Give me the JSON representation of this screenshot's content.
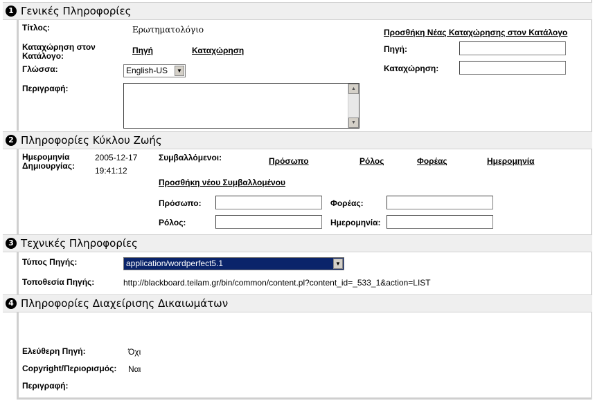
{
  "general": {
    "num": "1",
    "title": "Γενικές Πληροφορίες",
    "title_label": "Τίτλος:",
    "title_value": "Ερωτηματολόγιο",
    "catalog_label": "Καταχώρηση στον Κατάλογο:",
    "col_source": "Πηγή",
    "col_entry": "Καταχώρηση",
    "language_label": "Γλώσσα:",
    "language_value": "English-US",
    "description_label": "Περιγραφή:",
    "add_catalog_link": "Προσθήκη Νέας Καταχώρησης στον Κατάλογο",
    "source_label": "Πηγή:",
    "entry_label": "Καταχώρηση:"
  },
  "lifecycle": {
    "num": "2",
    "title": "Πληροφορίες Κύκλου Ζωής",
    "created_label": "Ημερομηνία Δημιουργίας:",
    "created_date": "2005-12-17",
    "created_time": "19:41:12",
    "contributors_label": "Συμβαλλόμενοι:",
    "col_person": "Πρόσωπο",
    "col_role": "Ρόλος",
    "col_org": "Φορέας",
    "col_date": "Ημερομηνία",
    "add_contributor_link": "Προσθήκη νέου Συμβαλλομένου",
    "person_label": "Πρόσωπο:",
    "org_label": "Φορέας:",
    "role_label": "Ρόλος:",
    "date_label": "Ημερομηνία:"
  },
  "technical": {
    "num": "3",
    "title": "Τεχνικές Πληροφορίες",
    "type_label": "Τύπος Πηγής:",
    "type_value": "application/wordperfect5.1",
    "location_label": "Τοποθεσία Πηγής:",
    "location_value": "http://blackboard.teilam.gr/bin/common/content.pl?content_id=_533_1&action=LIST"
  },
  "rights": {
    "num": "4",
    "title": "Πληροφορίες Διαχείρισης Δικαιωμάτων",
    "free_label": "Ελεύθερη Πηγή:",
    "free_value": "Όχι",
    "copyright_label": "Copyright/Περιορισμός:",
    "copyright_value": "Ναι",
    "description_label": "Περιγραφή:"
  }
}
